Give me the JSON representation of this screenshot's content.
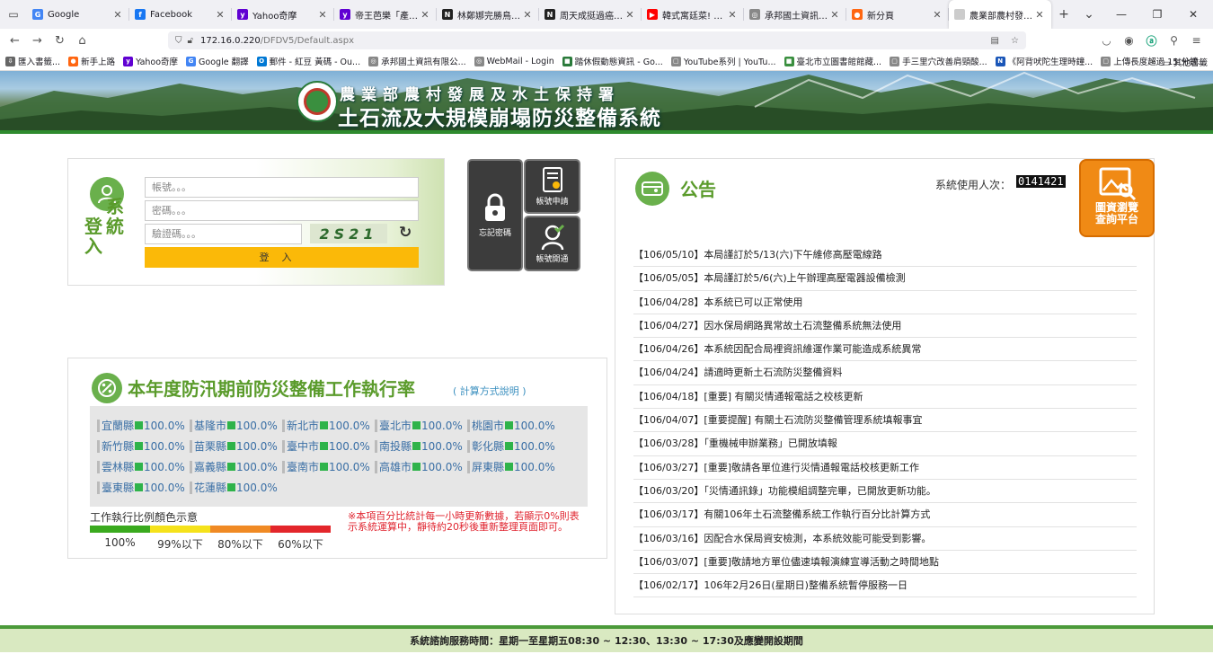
{
  "browser": {
    "tabs": [
      {
        "title": "Google",
        "icon": "google-icon",
        "color": "#4285f4",
        "glyph": "G"
      },
      {
        "title": "Facebook",
        "icon": "facebook-icon",
        "color": "#1877f2",
        "glyph": "f"
      },
      {
        "title": "Yahoo奇摩",
        "icon": "yahoo-icon",
        "color": "#6001d2",
        "glyph": "y"
      },
      {
        "title": "帝王芭樂「產量僅剩",
        "icon": "yahoo-icon",
        "color": "#6001d2",
        "glyph": "y"
      },
      {
        "title": "林鄭娜完勝鳥益別判",
        "icon": "news-icon",
        "color": "#222",
        "glyph": "N"
      },
      {
        "title": "周天成挺過癌症低米",
        "icon": "news-icon",
        "color": "#222",
        "glyph": "N"
      },
      {
        "title": "韓式寓廷菜! 蒸牛排",
        "icon": "youtube-icon",
        "color": "#ff0000",
        "glyph": "▶"
      },
      {
        "title": "承邦國土資訊有限公司-",
        "icon": "globe-icon",
        "color": "#888",
        "glyph": "◎"
      },
      {
        "title": "新分頁",
        "icon": "firefox-icon",
        "color": "#ff6611",
        "glyph": "●"
      },
      {
        "title": "農業部農村發展及水土保",
        "icon": "page-icon",
        "color": "#ccc",
        "glyph": ""
      }
    ],
    "url_host": "172.16.0.220",
    "url_path": "/DFDV5/Default.aspx",
    "bookmarks": [
      {
        "label": "匯入書籤...",
        "color": "#666",
        "glyph": "⇩"
      },
      {
        "label": "新手上路",
        "color": "#ff6611",
        "glyph": "●"
      },
      {
        "label": "Yahoo奇摩",
        "color": "#6001d2",
        "glyph": "y"
      },
      {
        "label": "Google 翻譯",
        "color": "#4285f4",
        "glyph": "G"
      },
      {
        "label": "郵件 - 紅豆 黃碼 - Ou...",
        "color": "#0078d4",
        "glyph": "O"
      },
      {
        "label": "承邦國土資訊有限公...",
        "color": "#888",
        "glyph": "◎"
      },
      {
        "label": "WebMail - Login",
        "color": "#888",
        "glyph": "◎"
      },
      {
        "label": "踏休假動態資訊 - Go...",
        "color": "#2a7a3a",
        "glyph": "■"
      },
      {
        "label": "YouTube系列 | YouTu...",
        "color": "#888",
        "glyph": "▢"
      },
      {
        "label": "臺北市立圖書館館藏...",
        "color": "#3a8f3f",
        "glyph": "■"
      },
      {
        "label": "手三里穴改善肩頸酸...",
        "color": "#888",
        "glyph": "▢"
      },
      {
        "label": "《阿背吠陀生理時鐘...",
        "color": "#1a56b8",
        "glyph": "N"
      },
      {
        "label": "上傳長度超過 15 分鐘...",
        "color": "#888",
        "glyph": "▢"
      }
    ],
    "other_bookmarks": "其他書籤"
  },
  "banner": {
    "agency": "農業部農村發展及水土保持署",
    "system": "土石流及大規模崩塌防災整備系統"
  },
  "login": {
    "title": "登入系統",
    "title_col1": "登入",
    "title_col2": "系統",
    "account_placeholder": "帳號。。。",
    "password_placeholder": "密碼。。。",
    "captcha_placeholder": "驗證碼。。。",
    "captcha_code": "2S21",
    "login_button": "登入",
    "forgot_password": "忘記密碼",
    "apply_account": "帳號申請",
    "activate_account": "帳號開通"
  },
  "notice": {
    "title": "公告",
    "counter_label": "系統使用人次：",
    "counter_value": "0141421",
    "gallery_label_1": "圖資瀏覽",
    "gallery_label_2": "查詢平台",
    "items": [
      "【106/05/10】本局謹訂於5/13(六)下午維修高壓電線路",
      "【106/05/05】本局謹訂於5/6(六)上午辦理高壓電器設備檢測",
      "【106/04/28】本系統已可以正常使用",
      "【106/04/27】因水保局網路異常故土石流整備系統無法使用",
      "【106/04/26】本系統因配合局裡資訊維運作業可能造成系統異常",
      "【106/04/24】請適時更新土石流防災整備資料",
      "【106/04/18】[重要] 有關災情通報電話之校核更新",
      "【106/04/07】[重要提醒] 有關土石流防災整備管理系統填報事宜",
      "【106/03/28】「重機械申辦業務」已開放填報",
      "【106/03/27】[重要]敬請各單位進行災情通報電話校核更新工作",
      "【106/03/20】「災情通訊錄」功能模組調整完畢，已開放更新功能。",
      "【106/03/17】有關106年土石流整備系統工作執行百分比計算方式",
      "【106/03/16】因配合水保局資安檢測，本系統效能可能受到影響。",
      "【106/03/07】[重要]敬請地方單位儘速填報演練宣導活動之時間地點",
      "【106/02/17】106年2月26日(星期日)整備系統暫停服務一日"
    ]
  },
  "rate": {
    "title": "本年度防汛期前防災整備工作執行率",
    "help": "( 計算方式說明 )",
    "counties": [
      [
        {
          "name": "宜蘭縣",
          "value": "100.0%"
        },
        {
          "name": "基隆市",
          "value": "100.0%"
        },
        {
          "name": "新北市",
          "value": "100.0%"
        },
        {
          "name": "臺北市",
          "value": "100.0%"
        },
        {
          "name": "桃園市",
          "value": "100.0%"
        }
      ],
      [
        {
          "name": "新竹縣",
          "value": "100.0%"
        },
        {
          "name": "苗栗縣",
          "value": "100.0%"
        },
        {
          "name": "臺中市",
          "value": "100.0%"
        },
        {
          "name": "南投縣",
          "value": "100.0%"
        },
        {
          "name": "彰化縣",
          "value": "100.0%"
        }
      ],
      [
        {
          "name": "雲林縣",
          "value": "100.0%"
        },
        {
          "name": "嘉義縣",
          "value": "100.0%"
        },
        {
          "name": "臺南市",
          "value": "100.0%"
        },
        {
          "name": "高雄市",
          "value": "100.0%"
        },
        {
          "name": "屏東縣",
          "value": "100.0%"
        }
      ],
      [
        {
          "name": "臺東縣",
          "value": "100.0%"
        },
        {
          "name": "花蓮縣",
          "value": "100.0%"
        }
      ]
    ],
    "legend_title": "工作執行比例顏色示意",
    "legend": [
      {
        "label": "100%",
        "color": "#3aaa1e"
      },
      {
        "label": "99%以下",
        "color": "#f5e21b"
      },
      {
        "label": "80%以下",
        "color": "#f08a24"
      },
      {
        "label": "60%以下",
        "color": "#e3262b"
      }
    ],
    "warning": "※本項百分比統計每一小時更新數據，若顯示0%則表示系統運算中，靜待約20秒後重新整理頁面即可。"
  },
  "footer": "系統諮詢服務時間：星期一至星期五08:30 ~ 12:30、13:30 ~ 17:30及應變開設期間"
}
